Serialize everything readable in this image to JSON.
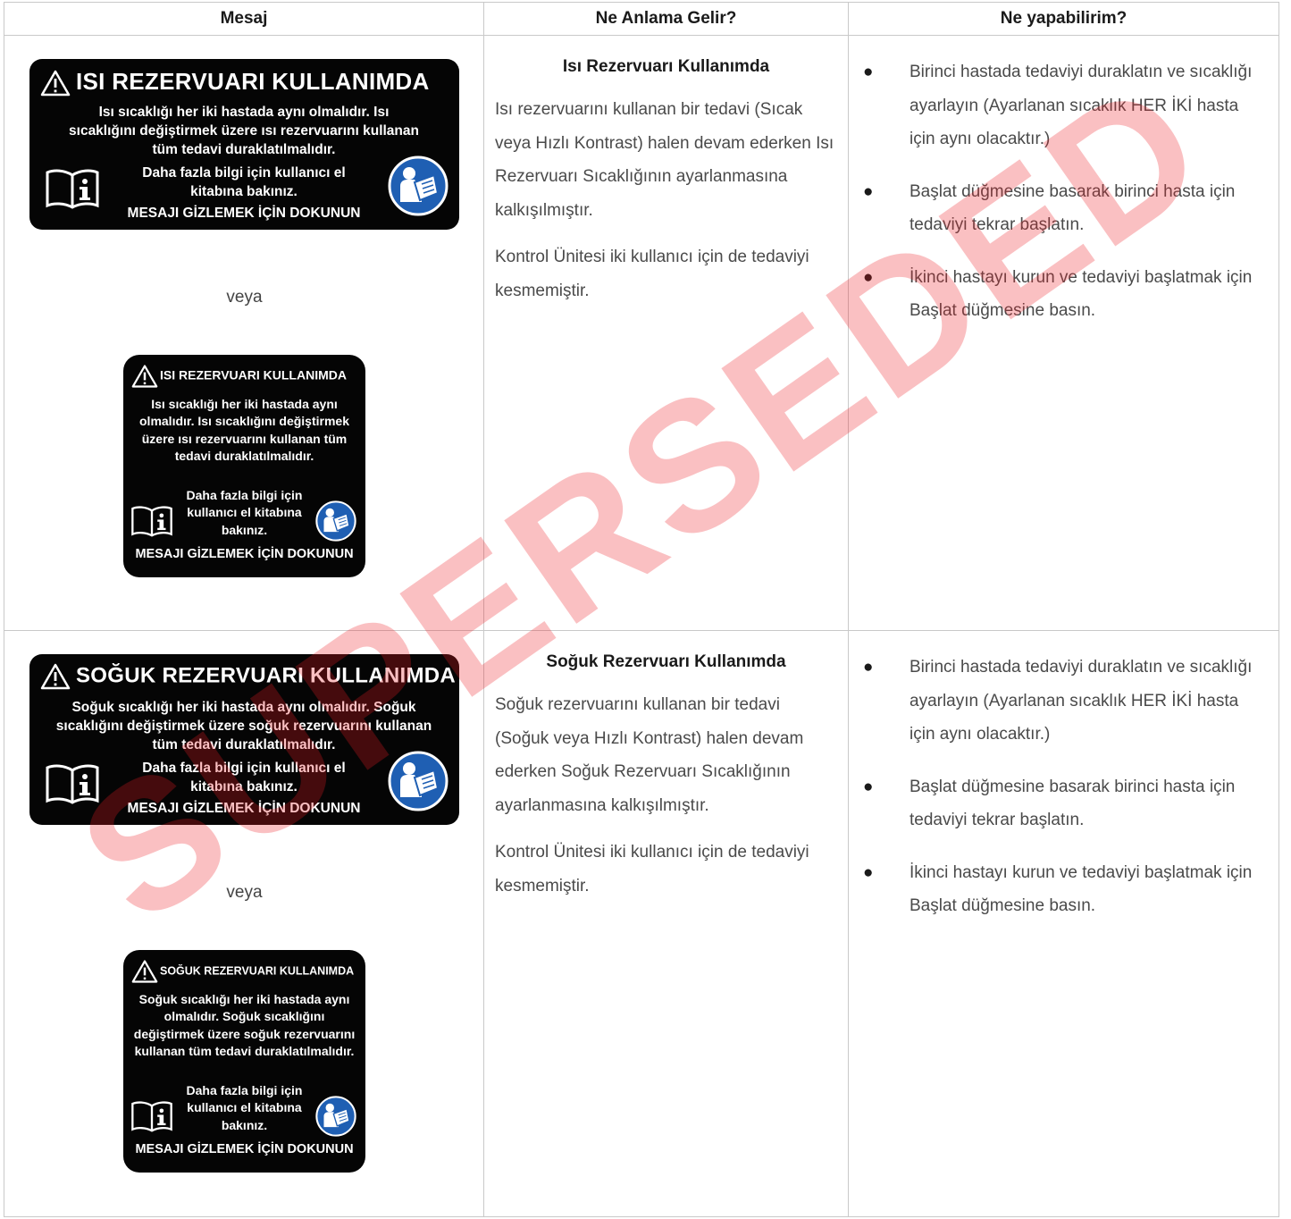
{
  "header": {
    "col1": "Mesaj",
    "col2": "Ne Anlama Gelir?",
    "col3": "Ne yapabilirim?"
  },
  "rows": [
    {
      "screen_large": {
        "title": "ISI REZERVUARI KULLANIMDA",
        "body": "Isı sıcaklığı her iki hastada aynı olmalıdır. Isı sıcaklığını değiştirmek üzere ısı rezervuarını kullanan tüm tedavi duraklatılmalıdır.",
        "more": "Daha fazla bilgi için kullanıcı el kitabına bakınız.",
        "hide": "MESAJI GİZLEMEK İÇİN DOKUNUN"
      },
      "or": "veya",
      "screen_small": {
        "title": "ISI REZERVUARI KULLANIMDA",
        "body": "Isı sıcaklığı her iki hastada aynı olmalıdır. Isı sıcaklığını değiştirmek üzere ısı rezervuarını kullanan tüm tedavi duraklatılmalıdır.",
        "more": "Daha fazla bilgi için kullanıcı el kitabına bakınız.",
        "hide": "MESAJI GİZLEMEK İÇİN DOKUNUN"
      },
      "meaning_title": "Isı Rezervuarı Kullanımda",
      "meaning_p1": "Isı rezervuarını kullanan bir tedavi (Sıcak veya Hızlı Kontrast) halen devam ederken Isı Rezervuarı Sıcaklığının ayarlanmasına kalkışılmıştır.",
      "meaning_p2": "Kontrol Ünitesi iki kullanıcı için de tedaviyi kesmemiştir.",
      "actions": [
        "Birinci hastada tedaviyi duraklatın ve sıcaklığı ayarlayın (Ayarlanan sıcaklık HER İKİ hasta için aynı olacaktır.)",
        "Başlat düğmesine basarak birinci hasta için tedaviyi tekrar başlatın.",
        "İkinci hastayı kurun ve tedaviyi başlatmak için Başlat düğmesine basın."
      ]
    },
    {
      "screen_large": {
        "title": "SOĞUK REZERVUARI KULLANIMDA",
        "body": "Soğuk sıcaklığı her iki hastada aynı olmalıdır. Soğuk sıcaklığını değiştirmek üzere soğuk rezervuarını kullanan tüm tedavi duraklatılmalıdır.",
        "more": "Daha fazla bilgi için kullanıcı el kitabına bakınız.",
        "hide": "MESAJI GİZLEMEK İÇİN DOKUNUN"
      },
      "or": "veya",
      "screen_small": {
        "title": "SOĞUK REZERVUARI KULLANIMDA",
        "body": "Soğuk sıcaklığı her iki hastada aynı olmalıdır. Soğuk sıcaklığını değiştirmek üzere soğuk rezervuarını kullanan tüm tedavi duraklatılmalıdır.",
        "more": "Daha fazla bilgi için kullanıcı el kitabına bakınız.",
        "hide": "MESAJI GİZLEMEK İÇİN DOKUNUN"
      },
      "meaning_title": "Soğuk Rezervuarı Kullanımda",
      "meaning_p1": "Soğuk rezervuarını kullanan bir tedavi (Soğuk veya Hızlı Kontrast) halen devam ederken Soğuk Rezervuarı Sıcaklığının ayarlanmasına kalkışılmıştır.",
      "meaning_p2": "Kontrol Ünitesi iki kullanıcı için de tedaviyi kesmemiştir.",
      "actions": [
        "Birinci hastada tedaviyi duraklatın ve sıcaklığı ayarlayın (Ayarlanan sıcaklık HER İKİ hasta için aynı olacaktır.)",
        "Başlat düğmesine basarak birinci hasta için tedaviyi tekrar başlatın.",
        "İkinci hastayı kurun ve tedaviyi başlatmak için Başlat düğmesine basın."
      ]
    }
  ],
  "watermark": "SUPERSEDED",
  "colors": {
    "watermark": "#ec1e24",
    "screen_bg": "#050505",
    "reader_icon": "#1f5fb3"
  },
  "icons": [
    "warning-triangle-icon",
    "manual-book-icon",
    "read-manual-icon"
  ]
}
